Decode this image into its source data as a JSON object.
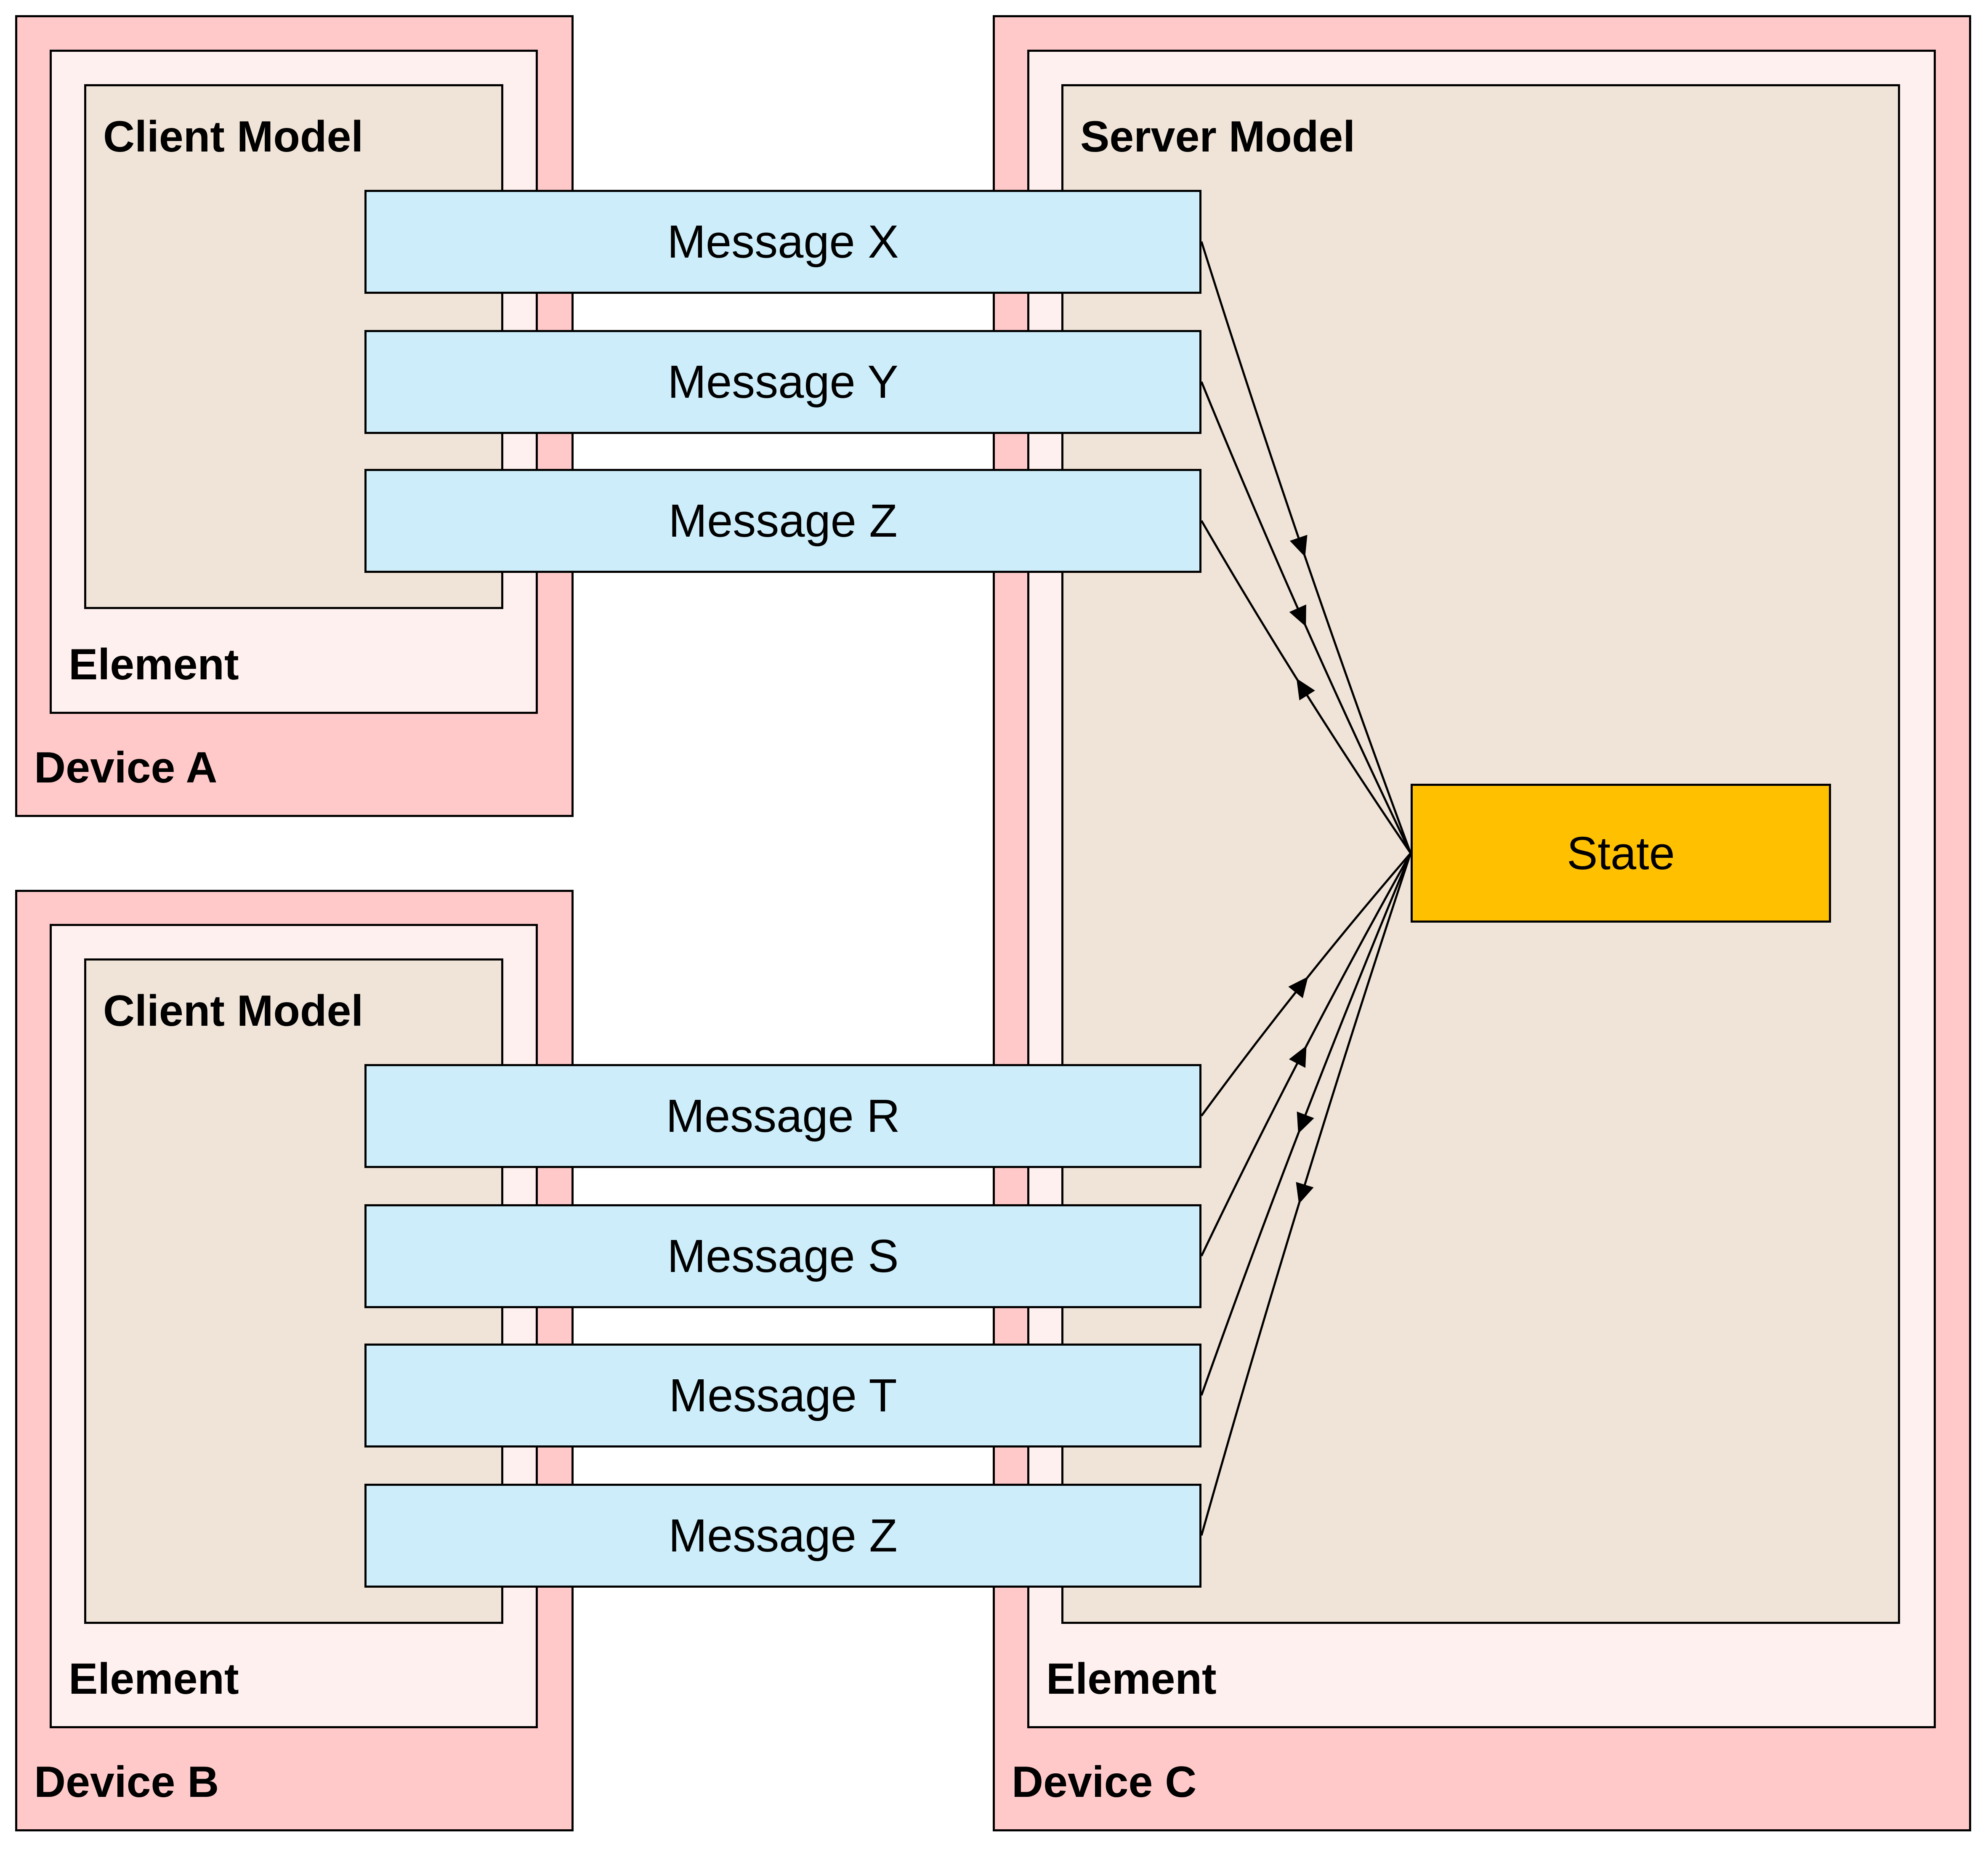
{
  "devices": [
    {
      "label": "Device A",
      "element_label": "Element",
      "model_label": "Client Model"
    },
    {
      "label": "Device B",
      "element_label": "Element",
      "model_label": "Client Model"
    },
    {
      "label": "Device C",
      "element_label": "Element",
      "model_label": "Server Model"
    }
  ],
  "messages_a": [
    {
      "label": "Message X",
      "direction": "to-state"
    },
    {
      "label": "Message Y",
      "direction": "to-state"
    },
    {
      "label": "Message Z",
      "direction": "from-state"
    }
  ],
  "messages_b": [
    {
      "label": "Message R",
      "direction": "to-state"
    },
    {
      "label": "Message S",
      "direction": "to-state"
    },
    {
      "label": "Message T",
      "direction": "from-state"
    },
    {
      "label": "Message Z",
      "direction": "from-state"
    }
  ],
  "state": {
    "label": "State"
  },
  "colors": {
    "device": "#FFC9C9",
    "element": "#FEF0EE",
    "model": "#F0E4D8",
    "message": "#CCEDF9",
    "state": "#FFC000"
  }
}
